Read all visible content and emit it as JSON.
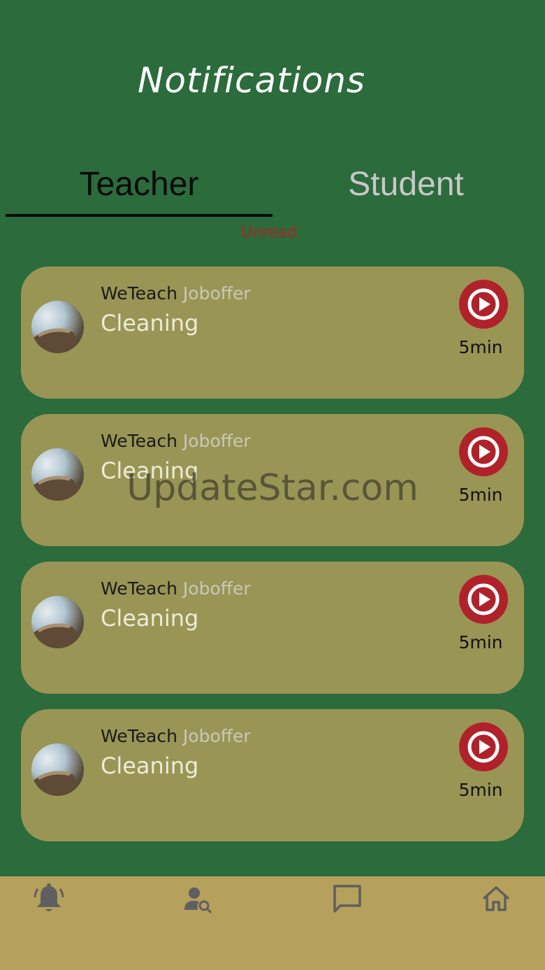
{
  "header": {
    "title": "Notifications"
  },
  "tabs": [
    {
      "label": "Teacher",
      "active": true
    },
    {
      "label": "Student",
      "active": false
    }
  ],
  "filter": {
    "label": "Unread"
  },
  "notifications": [
    {
      "sender": "WeTeach",
      "type": "Joboffer",
      "subject": "Cleaning",
      "time": "5min",
      "action_icon": "play-circle-icon"
    },
    {
      "sender": "WeTeach",
      "type": "Joboffer",
      "subject": "Cleaning",
      "time": "5min",
      "action_icon": "play-circle-icon"
    },
    {
      "sender": "WeTeach",
      "type": "Joboffer",
      "subject": "Cleaning",
      "time": "5min",
      "action_icon": "play-circle-icon"
    },
    {
      "sender": "WeTeach",
      "type": "Joboffer",
      "subject": "Cleaning",
      "time": "5min",
      "action_icon": "play-circle-icon"
    }
  ],
  "watermark": {
    "text": "UpdateStar.com"
  },
  "bottom_nav": [
    {
      "icon": "bell-icon"
    },
    {
      "icon": "person-search-icon"
    },
    {
      "icon": "chat-icon"
    },
    {
      "icon": "home-icon"
    }
  ],
  "colors": {
    "background": "#2b6b3c",
    "card": "#999555",
    "accent_red": "#b0222a",
    "nav_bar": "#b5a05c"
  }
}
